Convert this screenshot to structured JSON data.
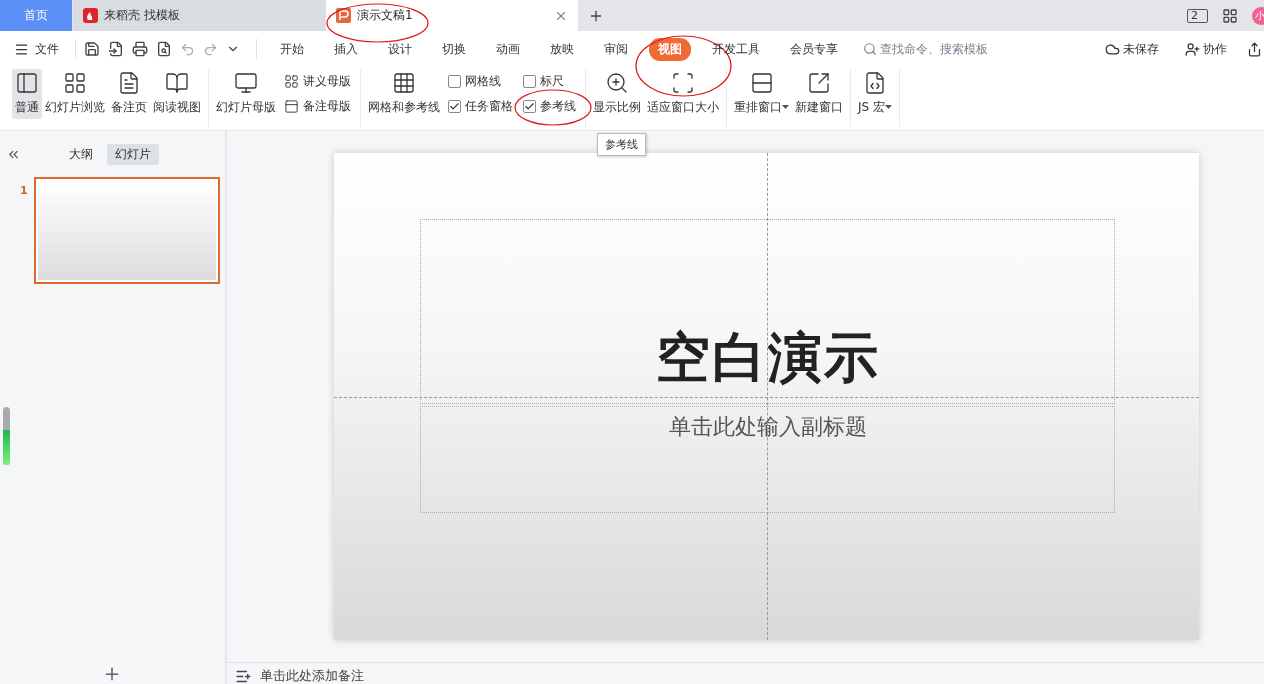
{
  "title_bar": {
    "tabs": [
      {
        "kind": "home",
        "label": "首页",
        "selected": false
      },
      {
        "kind": "web",
        "label": "来稻壳 找模板",
        "selected": false
      },
      {
        "kind": "doc",
        "label": "演示文稿1",
        "selected": true,
        "circled": true
      }
    ],
    "window_count": "2",
    "avatar": "小"
  },
  "menu_bar": {
    "file": "文件",
    "tabs": [
      {
        "label": "开始",
        "selected": false
      },
      {
        "label": "插入",
        "selected": false
      },
      {
        "label": "设计",
        "selected": false
      },
      {
        "label": "切换",
        "selected": false
      },
      {
        "label": "动画",
        "selected": false
      },
      {
        "label": "放映",
        "selected": false
      },
      {
        "label": "审阅",
        "selected": false
      },
      {
        "label": "视图",
        "selected": true,
        "circled": true
      },
      {
        "label": "开发工具",
        "selected": false
      },
      {
        "label": "会员专享",
        "selected": false
      }
    ],
    "search": {
      "placeholder": "查找命令、搜索模板"
    },
    "save_status": "未保存",
    "collab": "协作"
  },
  "ribbon": {
    "groups": [
      {
        "items": [
          {
            "kind": "large",
            "label": "普通",
            "selected": true
          },
          {
            "kind": "large",
            "label": "幻灯片浏览",
            "selected": false
          },
          {
            "kind": "large",
            "label": "备注页",
            "selected": false
          },
          {
            "kind": "large",
            "label": "阅读视图",
            "selected": false
          }
        ]
      },
      {
        "items": [
          {
            "kind": "large",
            "label": "幻灯片母版",
            "selected": false
          },
          {
            "kind": "stack",
            "items": [
              {
                "kind": "small",
                "label": "讲义母版"
              },
              {
                "kind": "small",
                "label": "备注母版"
              }
            ]
          }
        ]
      },
      {
        "items": [
          {
            "kind": "large",
            "label": "网格和参考线",
            "selected": false
          },
          {
            "kind": "stack",
            "items": [
              {
                "kind": "checkbox",
                "label": "网格线",
                "checked": false
              },
              {
                "kind": "checkbox",
                "label": "任务窗格",
                "checked": true
              }
            ]
          },
          {
            "kind": "stack",
            "items": [
              {
                "kind": "checkbox",
                "label": "标尺",
                "checked": false
              },
              {
                "kind": "checkbox",
                "label": "参考线",
                "checked": true,
                "circled": true
              }
            ]
          }
        ]
      },
      {
        "items": [
          {
            "kind": "large",
            "label": "显示比例",
            "selected": false
          },
          {
            "kind": "large",
            "label": "适应窗口大小",
            "selected": false
          }
        ]
      },
      {
        "items": [
          {
            "kind": "large",
            "label": "重排窗口",
            "selected": false,
            "dropdown": true
          },
          {
            "kind": "large",
            "label": "新建窗口",
            "selected": false
          }
        ]
      },
      {
        "items": [
          {
            "kind": "large",
            "label": "JS 宏",
            "selected": false,
            "dropdown": true
          }
        ]
      }
    ]
  },
  "tooltip": "参考线",
  "side_panel": {
    "tabs": [
      {
        "label": "大纲",
        "selected": false
      },
      {
        "label": "幻灯片",
        "selected": true
      }
    ],
    "slides": [
      {
        "number": "1",
        "selected": true
      }
    ],
    "meter": {
      "level": 0.6
    }
  },
  "slide": {
    "title": "空白演示",
    "subtitle": "单击此处输入副标题",
    "guides": true
  },
  "notes": {
    "placeholder": "单击此处添加备注"
  }
}
